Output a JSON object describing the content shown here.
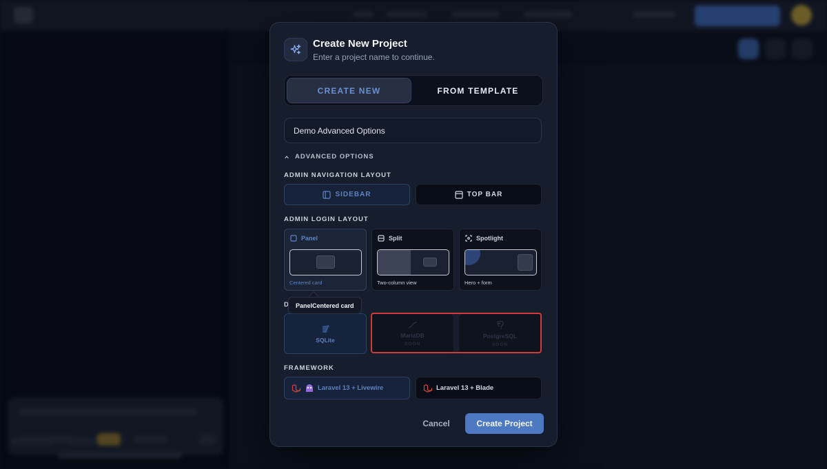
{
  "modal": {
    "title": "Create New Project",
    "subtitle": "Enter a project name to continue.",
    "tabs": [
      {
        "label": "CREATE NEW",
        "active": true
      },
      {
        "label": "FROM TEMPLATE",
        "active": false
      }
    ],
    "project_name_value": "Demo Advanced Options",
    "advanced_toggle_label": "ADVANCED OPTIONS",
    "admin_nav": {
      "label": "ADMIN NAVIGATION LAYOUT",
      "options": [
        {
          "label": "SIDEBAR",
          "selected": true
        },
        {
          "label": "TOP BAR",
          "selected": false
        }
      ]
    },
    "admin_login": {
      "label": "ADMIN LOGIN LAYOUT",
      "options": [
        {
          "title": "Panel",
          "caption": "Centered card",
          "selected": true
        },
        {
          "title": "Split",
          "caption": "Two-column view",
          "selected": false
        },
        {
          "title": "Spotlight",
          "caption": "Hero + form",
          "selected": false
        }
      ]
    },
    "tooltip": "PanelCentered card",
    "database": {
      "label_peek": "D",
      "options": [
        {
          "label": "SQLite",
          "selected": true
        },
        {
          "label": "MariaDB",
          "badge": "SOON",
          "disabled": true
        },
        {
          "label": "PostgreSQL",
          "badge": "SOON",
          "disabled": true
        }
      ]
    },
    "framework": {
      "label": "FRAMEWORK",
      "options": [
        {
          "label": "Laravel 13 + Livewire",
          "selected": true
        },
        {
          "label": "Laravel 13 + Blade",
          "selected": false
        }
      ]
    },
    "actions": {
      "cancel": "Cancel",
      "create": "Create Project"
    }
  },
  "colors": {
    "accent": "#4d78c2",
    "highlight": "#d23a3a",
    "laravel": "#d9453b",
    "livewire": "#8f6ad8"
  },
  "icons": {
    "header": "sparkles-icon",
    "advanced_toggle": "chevron-up-icon",
    "sidebar": "sidebar-layout-icon",
    "topbar": "topbar-layout-icon",
    "panel": "square-icon",
    "split": "rows-icon",
    "spotlight": "focus-icon",
    "sqlite": "sqlite-icon",
    "mariadb": "mariadb-icon",
    "postgresql": "postgresql-icon",
    "laravel": "laravel-icon",
    "livewire": "livewire-icon"
  }
}
